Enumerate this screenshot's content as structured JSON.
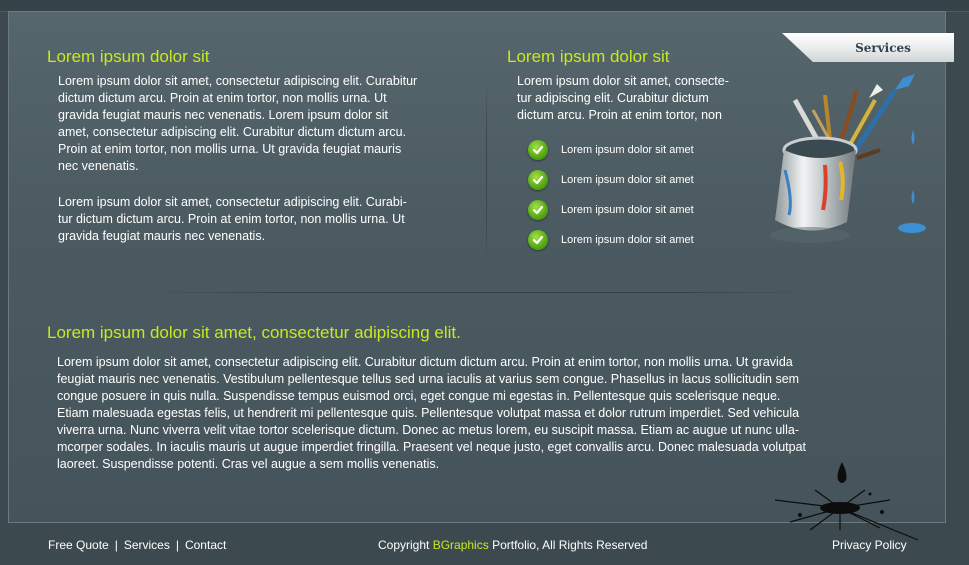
{
  "colors": {
    "accent": "#c6ea1c",
    "background": "#3c4a50",
    "panel": "#4f5f66",
    "text": "#ffffff"
  },
  "left_column": {
    "heading": "Lorem ipsum dolor sit",
    "paragraph1": [
      "Lorem ipsum dolor sit amet, consectetur adipiscing elit. Curabitur",
      "dictum dictum arcu. Proin at enim tortor, non mollis urna. Ut",
      "gravida feugiat mauris nec venenatis.  Lorem ipsum dolor sit",
      "amet, consectetur adipiscing elit. Curabitur dictum dictum arcu.",
      "Proin at enim tortor, non mollis urna. Ut gravida feugiat mauris",
      "nec venenatis."
    ],
    "paragraph2": [
      "Lorem ipsum dolor sit amet, consectetur adipiscing elit. Curabi-",
      "tur dictum dictum arcu. Proin at enim tortor, non mollis urna. Ut",
      "gravida feugiat mauris nec venenatis."
    ]
  },
  "right_column": {
    "heading": "Lorem ipsum dolor sit",
    "paragraph": [
      "Lorem ipsum dolor sit amet, consecte-",
      "tur adipiscing elit. Curabitur dictum",
      "dictum arcu. Proin at enim tortor, non"
    ],
    "list": [
      {
        "label": "Lorem ipsum dolor sit amet",
        "icon": "check-icon"
      },
      {
        "label": "Lorem ipsum dolor sit amet",
        "icon": "check-icon"
      },
      {
        "label": "Lorem ipsum dolor sit amet",
        "icon": "check-icon"
      },
      {
        "label": "Lorem ipsum dolor sit amet",
        "icon": "check-icon"
      }
    ]
  },
  "services_tab": {
    "label": "Services"
  },
  "bottom_section": {
    "heading": "Lorem ipsum dolor sit amet, consectetur adipiscing elit.",
    "paragraph": [
      "Lorem ipsum dolor sit amet, consectetur adipiscing elit. Curabitur dictum dictum arcu. Proin at enim tortor, non mollis urna. Ut gravida",
      "feugiat mauris nec venenatis. Vestibulum pellentesque tellus sed urna iaculis at varius sem congue. Phasellus in lacus sollicitudin sem",
      "congue posuere in quis nulla. Suspendisse tempus euismod orci, eget congue mi egestas in. Pellentesque quis scelerisque neque.",
      "Etiam malesuada egestas felis, ut hendrerit mi pellentesque quis. Pellentesque volutpat massa et dolor rutrum imperdiet. Sed vehicula",
      "viverra urna. Nunc viverra velit vitae tortor scelerisque dictum. Donec ac metus lorem, eu suscipit massa. Etiam ac augue ut nunc ulla-",
      "mcorper sodales. In iaculis mauris ut augue imperdiet fringilla. Praesent vel neque justo, eget convallis arcu. Donec malesuada volutpat",
      "laoreet. Suspendisse potenti. Cras vel augue a sem mollis venenatis."
    ]
  },
  "footer": {
    "links": [
      "Free Quote",
      "Services",
      "Contact"
    ],
    "separator": "|",
    "copyright_prefix": "Copyright ",
    "brand": "BGraphics",
    "copyright_suffix": " Portfolio, All Rights Reserved",
    "privacy": "Privacy Policy"
  }
}
